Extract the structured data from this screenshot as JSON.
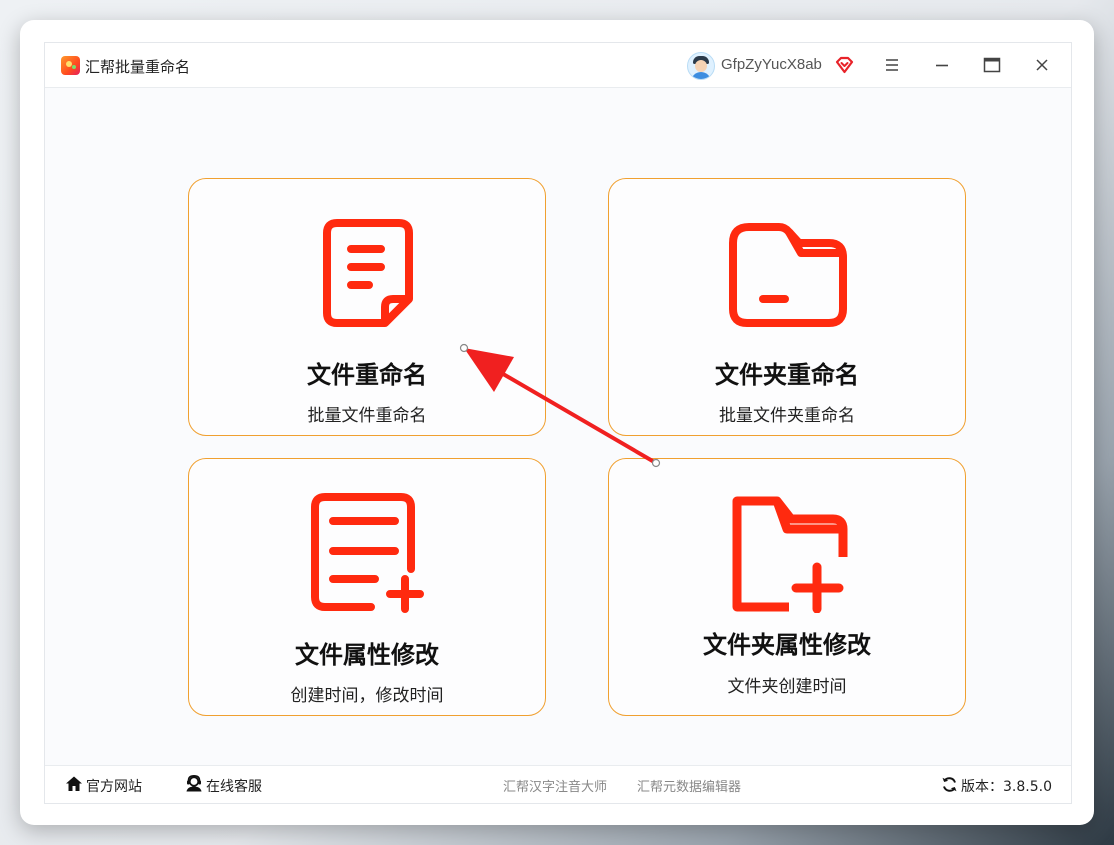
{
  "window": {
    "title": "汇帮批量重命名",
    "username": "GfpZyYucX8ab",
    "icons": {
      "logo": "app-logo-icon",
      "avatar": "user-avatar",
      "vip": "vip-diamond-icon",
      "menu": "hamburger-menu-icon",
      "minimize": "minimize-icon",
      "maximize": "maximize-icon",
      "close": "close-icon"
    }
  },
  "cards": [
    {
      "icon": "document-icon",
      "title": "文件重命名",
      "subtitle": "批量文件重命名"
    },
    {
      "icon": "folder-icon",
      "title": "文件夹重命名",
      "subtitle": "批量文件夹重命名"
    },
    {
      "icon": "document-add-icon",
      "title": "文件属性修改",
      "subtitle": "创建时间，修改时间"
    },
    {
      "icon": "folder-add-icon",
      "title": "文件夹属性修改",
      "subtitle": "文件夹创建时间"
    }
  ],
  "footer": {
    "home_label": "官方网站",
    "service_label": "在线客服",
    "promo_links": [
      "汇帮汉字注音大师",
      "汇帮元数据编辑器"
    ],
    "version_label": "版本：3.8.5.0"
  },
  "colors": {
    "accent_red": "#ff2a0f",
    "card_border": "#f0a030",
    "annotation_arrow": "#f02020"
  }
}
